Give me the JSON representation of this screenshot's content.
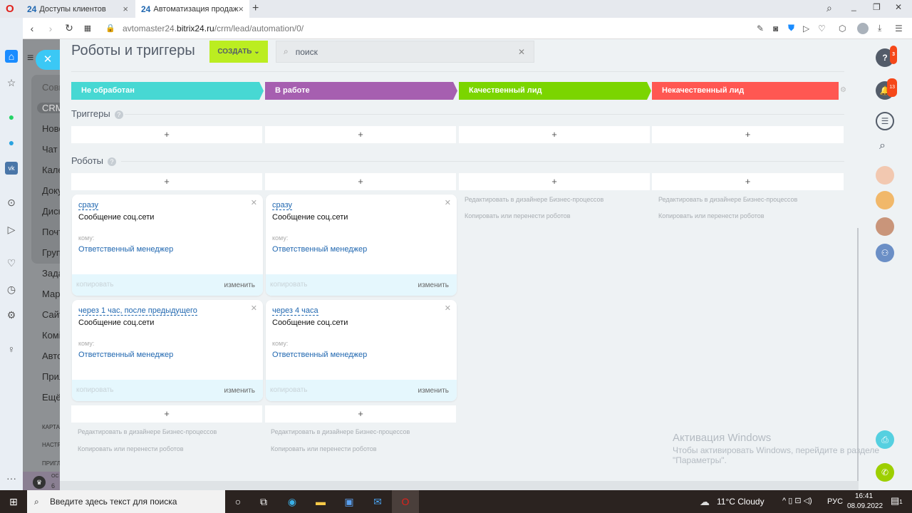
{
  "browser": {
    "tabs": [
      {
        "label": "Доступы клиентов"
      },
      {
        "label": "Автоматизация продаж"
      }
    ],
    "url_prefix": "avtomaster24.",
    "url_domain": "bitrix24.ru",
    "url_path": "/crm/lead/automation/0/"
  },
  "leftmenu": {
    "items": [
      "Совм",
      "CRM",
      "Ново",
      "Чат и",
      "Кале",
      "Доку",
      "Диск",
      "Почт",
      "Груп",
      "Зада",
      "Мар",
      "Сайт",
      "Комі",
      "Авто",
      "Прил",
      "Ещё"
    ],
    "small": [
      "КАРТА",
      "НАСТР",
      "ПРИГЛ"
    ],
    "plan": [
      "ОС",
      "6 Д"
    ]
  },
  "page": {
    "title": "Роботы и триггеры",
    "create_label": "СОЗДАТЬ",
    "search_placeholder": "поиск"
  },
  "stages": [
    {
      "label": "Не обработан",
      "color": "#47d8d3"
    },
    {
      "label": "В работе",
      "color": "#a65fb0"
    },
    {
      "label": "Качественный лид",
      "color": "#7bd500"
    },
    {
      "label": "Некачественный лид",
      "color": "#ff5752"
    }
  ],
  "sections": {
    "triggers": "Триггеры",
    "robots": "Роботы",
    "help": "?",
    "plus": "+"
  },
  "robots": [
    {
      "when": "сразу",
      "name": "Сообщение соц.сети",
      "to_label": "кому:",
      "to": "Ответственный менеджер",
      "copy": "копировать",
      "edit": "изменить"
    },
    {
      "when": "сразу",
      "name": "Сообщение соц.сети",
      "to_label": "кому:",
      "to": "Ответственный менеджер",
      "copy": "копировать",
      "edit": "изменить"
    },
    {
      "when": "через 1 час, после предыдущего",
      "name": "Сообщение соц.сети",
      "to_label": "кому:",
      "to": "Ответственный менеджер",
      "copy": "копировать",
      "edit": "изменить"
    },
    {
      "when": "через 4 часа",
      "name": "Сообщение соц.сети",
      "to_label": "кому:",
      "to": "Ответственный менеджер",
      "copy": "копировать",
      "edit": "изменить"
    }
  ],
  "links": {
    "designer": "Редактировать в дизайнере Бизнес-процессов",
    "copy_move": "Копировать или перенести роботов"
  },
  "rightpanel": {
    "help_badge": "3",
    "notif_badge": "13"
  },
  "watermark": {
    "title": "Активация Windows",
    "text": "Чтобы активировать Windows, перейдите в разделе",
    "text2": "\"Параметры\"."
  },
  "taskbar": {
    "search": "Введите здесь текст для поиска",
    "weather": "11°C  Cloudy",
    "lang": "РУС",
    "time": "16:41",
    "date": "08.09.2022",
    "notif": "1"
  }
}
